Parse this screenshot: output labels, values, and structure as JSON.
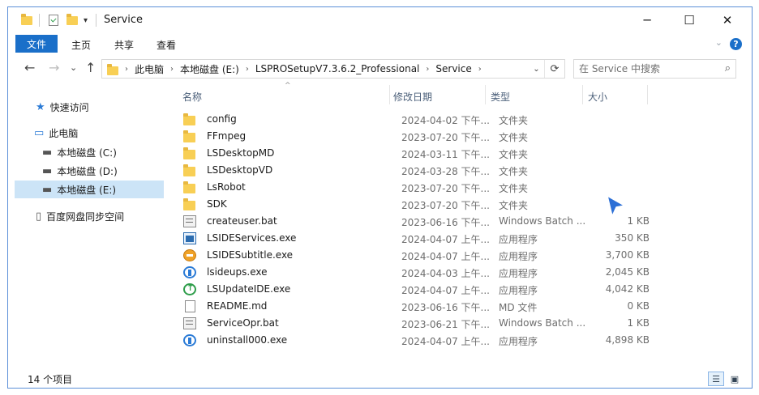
{
  "window": {
    "title": "Service",
    "minimize_glyph": "─",
    "maximize_glyph": "☐",
    "close_glyph": "✕"
  },
  "quick_access": {
    "dropdown_glyph": "▾"
  },
  "ribbon": {
    "file_tab": "文件",
    "tabs": [
      "主页",
      "共享",
      "查看"
    ],
    "collapse_glyph": "⌄",
    "help_glyph": "?"
  },
  "nav": {
    "back_glyph": "←",
    "forward_glyph": "→",
    "recent_glyph": "⌄",
    "up_glyph": "↑",
    "breadcrumb": [
      "此电脑",
      "本地磁盘 (E:)",
      "LSPROSetupV7.3.6.2_Professional",
      "Service"
    ],
    "breadcrumb_sep": "›",
    "addr_dropdown_glyph": "⌄",
    "refresh_glyph": "⟳",
    "search_placeholder": "在 Service 中搜索",
    "search_glyph": "⌕"
  },
  "sidebar": {
    "items": [
      {
        "label": "快速访问",
        "icon": "star-icon",
        "glyph": "★",
        "color": "#2b7bd6"
      },
      {
        "label": "此电脑",
        "icon": "computer-icon",
        "glyph": "▭",
        "color": "#2b7bd6"
      },
      {
        "label": "本地磁盘 (C:)",
        "icon": "drive-windows-icon",
        "glyph": "▬",
        "color": "#555555"
      },
      {
        "label": "本地磁盘 (D:)",
        "icon": "drive-icon",
        "glyph": "▬",
        "color": "#555555"
      },
      {
        "label": "本地磁盘 (E:)",
        "icon": "drive-icon",
        "glyph": "▬",
        "color": "#555555"
      },
      {
        "label": "百度网盘同步空间",
        "icon": "cloud-folder-icon",
        "glyph": "▯",
        "color": "#555555"
      }
    ],
    "selected_index": 4
  },
  "columns": {
    "name": "名称",
    "date": "修改日期",
    "type": "类型",
    "size": "大小",
    "sort_glyph": "^"
  },
  "files": [
    {
      "name": "config",
      "date": "2024-04-02 下午...",
      "type": "文件夹",
      "size": "",
      "icon": "folder"
    },
    {
      "name": "FFmpeg",
      "date": "2023-07-20 下午...",
      "type": "文件夹",
      "size": "",
      "icon": "folder"
    },
    {
      "name": "LSDesktopMD",
      "date": "2024-03-11 下午...",
      "type": "文件夹",
      "size": "",
      "icon": "folder"
    },
    {
      "name": "LSDesktopVD",
      "date": "2024-03-28 下午...",
      "type": "文件夹",
      "size": "",
      "icon": "folder"
    },
    {
      "name": "LsRobot",
      "date": "2023-07-20 下午...",
      "type": "文件夹",
      "size": "",
      "icon": "folder"
    },
    {
      "name": "SDK",
      "date": "2023-07-20 下午...",
      "type": "文件夹",
      "size": "",
      "icon": "folder"
    },
    {
      "name": "createuser.bat",
      "date": "2023-06-16 下午...",
      "type": "Windows Batch ...",
      "size": "1 KB",
      "icon": "bat"
    },
    {
      "name": "LSIDEServices.exe",
      "date": "2024-04-07 上午...",
      "type": "应用程序",
      "size": "350 KB",
      "icon": "exe-blue"
    },
    {
      "name": "LSIDESubtitle.exe",
      "date": "2024-04-07 上午...",
      "type": "应用程序",
      "size": "3,700 KB",
      "icon": "exe-orange"
    },
    {
      "name": "lsideups.exe",
      "date": "2024-04-03 上午...",
      "type": "应用程序",
      "size": "2,045 KB",
      "icon": "exe-ring"
    },
    {
      "name": "LSUpdateIDE.exe",
      "date": "2024-04-07 上午...",
      "type": "应用程序",
      "size": "4,042 KB",
      "icon": "exe-green"
    },
    {
      "name": "README.md",
      "date": "2023-06-16 下午...",
      "type": "MD 文件",
      "size": "0 KB",
      "icon": "doc"
    },
    {
      "name": "ServiceOpr.bat",
      "date": "2023-06-21 下午...",
      "type": "Windows Batch ...",
      "size": "1 KB",
      "icon": "bat"
    },
    {
      "name": "uninstall000.exe",
      "date": "2024-04-07 上午...",
      "type": "应用程序",
      "size": "4,898 KB",
      "icon": "exe-ring"
    }
  ],
  "status": {
    "count": "14 个项目"
  },
  "view_buttons": {
    "details_glyph": "☰",
    "thumbs_glyph": "▣"
  },
  "colors": {
    "accent": "#1a6fc9",
    "selection": "#cce4f7",
    "border": "#5b8fd8",
    "cursor": "#2b6fd6"
  }
}
